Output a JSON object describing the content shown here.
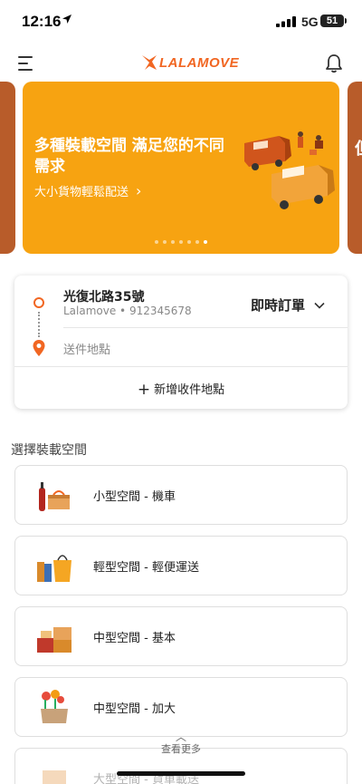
{
  "status_bar": {
    "time": "12:16",
    "network": "5G",
    "battery": "51"
  },
  "header": {
    "logo_text": "LALAMOVE",
    "colors": {
      "brand": "#f16622"
    }
  },
  "banner": {
    "title": "多種裝載空間 滿足您的不同需求",
    "subtitle": "大小貨物輕鬆配送",
    "peek_text": "但",
    "dots_total": 7,
    "dots_active": 7,
    "colors": {
      "background": "#f7a311"
    }
  },
  "route": {
    "pickup_title": "光復北路35號",
    "pickup_sub": "Lalamove • 912345678",
    "order_type": "即時訂單",
    "drop_placeholder": "送件地點",
    "add_stop": "新增收件地點"
  },
  "vehicles": {
    "section_title": "選擇裝載空間",
    "items": [
      {
        "name": "小型空間 - 機車",
        "icon": "motorcycle-cargo-icon"
      },
      {
        "name": "輕型空間 - 輕便運送",
        "icon": "light-cargo-icon"
      },
      {
        "name": "中型空間 - 基本",
        "icon": "medium-cargo-icon"
      },
      {
        "name": "中型空間 - 加大",
        "icon": "medium-large-cargo-icon"
      },
      {
        "name": "大型空間 - 貨車載送",
        "icon": "large-cargo-icon"
      }
    ]
  },
  "footer": {
    "more_label": "查看更多"
  }
}
